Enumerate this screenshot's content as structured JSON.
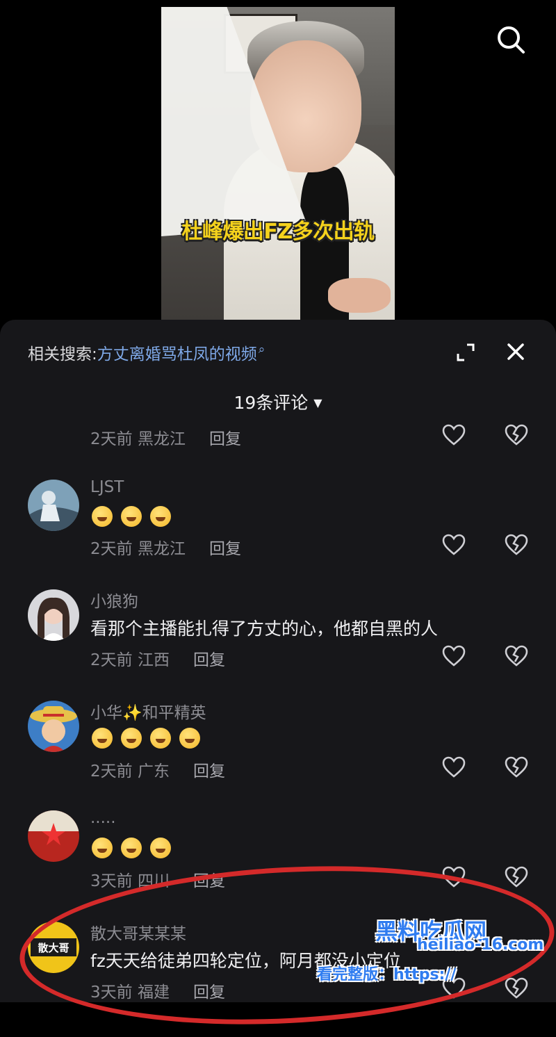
{
  "video": {
    "caption": "杜峰爆出FZ多次出轨"
  },
  "related_search": {
    "label": "相关搜索:",
    "query": "方丈离婚骂杜凤的视频"
  },
  "comments_header": {
    "count_label": "19条评论"
  },
  "comments": [
    {
      "name": "",
      "text": "",
      "time": "2天前",
      "location": "黑龙江",
      "reply": "回复"
    },
    {
      "name": "LJST",
      "emoji": "yawning-face",
      "emoji_count": 3,
      "time": "2天前",
      "location": "黑龙江",
      "reply": "回复"
    },
    {
      "name": "小狼狗",
      "text": "看那个主播能扎得了方丈的心，他都自黑的人",
      "time": "2天前",
      "location": "江西",
      "reply": "回复"
    },
    {
      "name": "小华✨和平精英",
      "emoji": "upside-down-face",
      "emoji_count": 4,
      "time": "2天前",
      "location": "广东",
      "reply": "回复"
    },
    {
      "name": ".....",
      "emoji": "grinning-face",
      "emoji_count": 3,
      "time": "3天前",
      "location": "四川",
      "reply": "回复"
    },
    {
      "name": "散大哥某某某",
      "text": "fz天天给徒弟四轮定位，阿月都没小定位",
      "time": "3天前",
      "location": "福建",
      "reply": "回复",
      "avatar_text": "散大哥"
    }
  ],
  "watermark": {
    "brand": "黑料吃瓜网",
    "url": "heiliao-16.com",
    "prompt": "看完整版：https://"
  },
  "colors": {
    "sheet_bg": "#17171a",
    "accent_link": "#7fa9e8",
    "highlight_circle": "#d42a2a",
    "watermark": "#2f7cf0"
  }
}
